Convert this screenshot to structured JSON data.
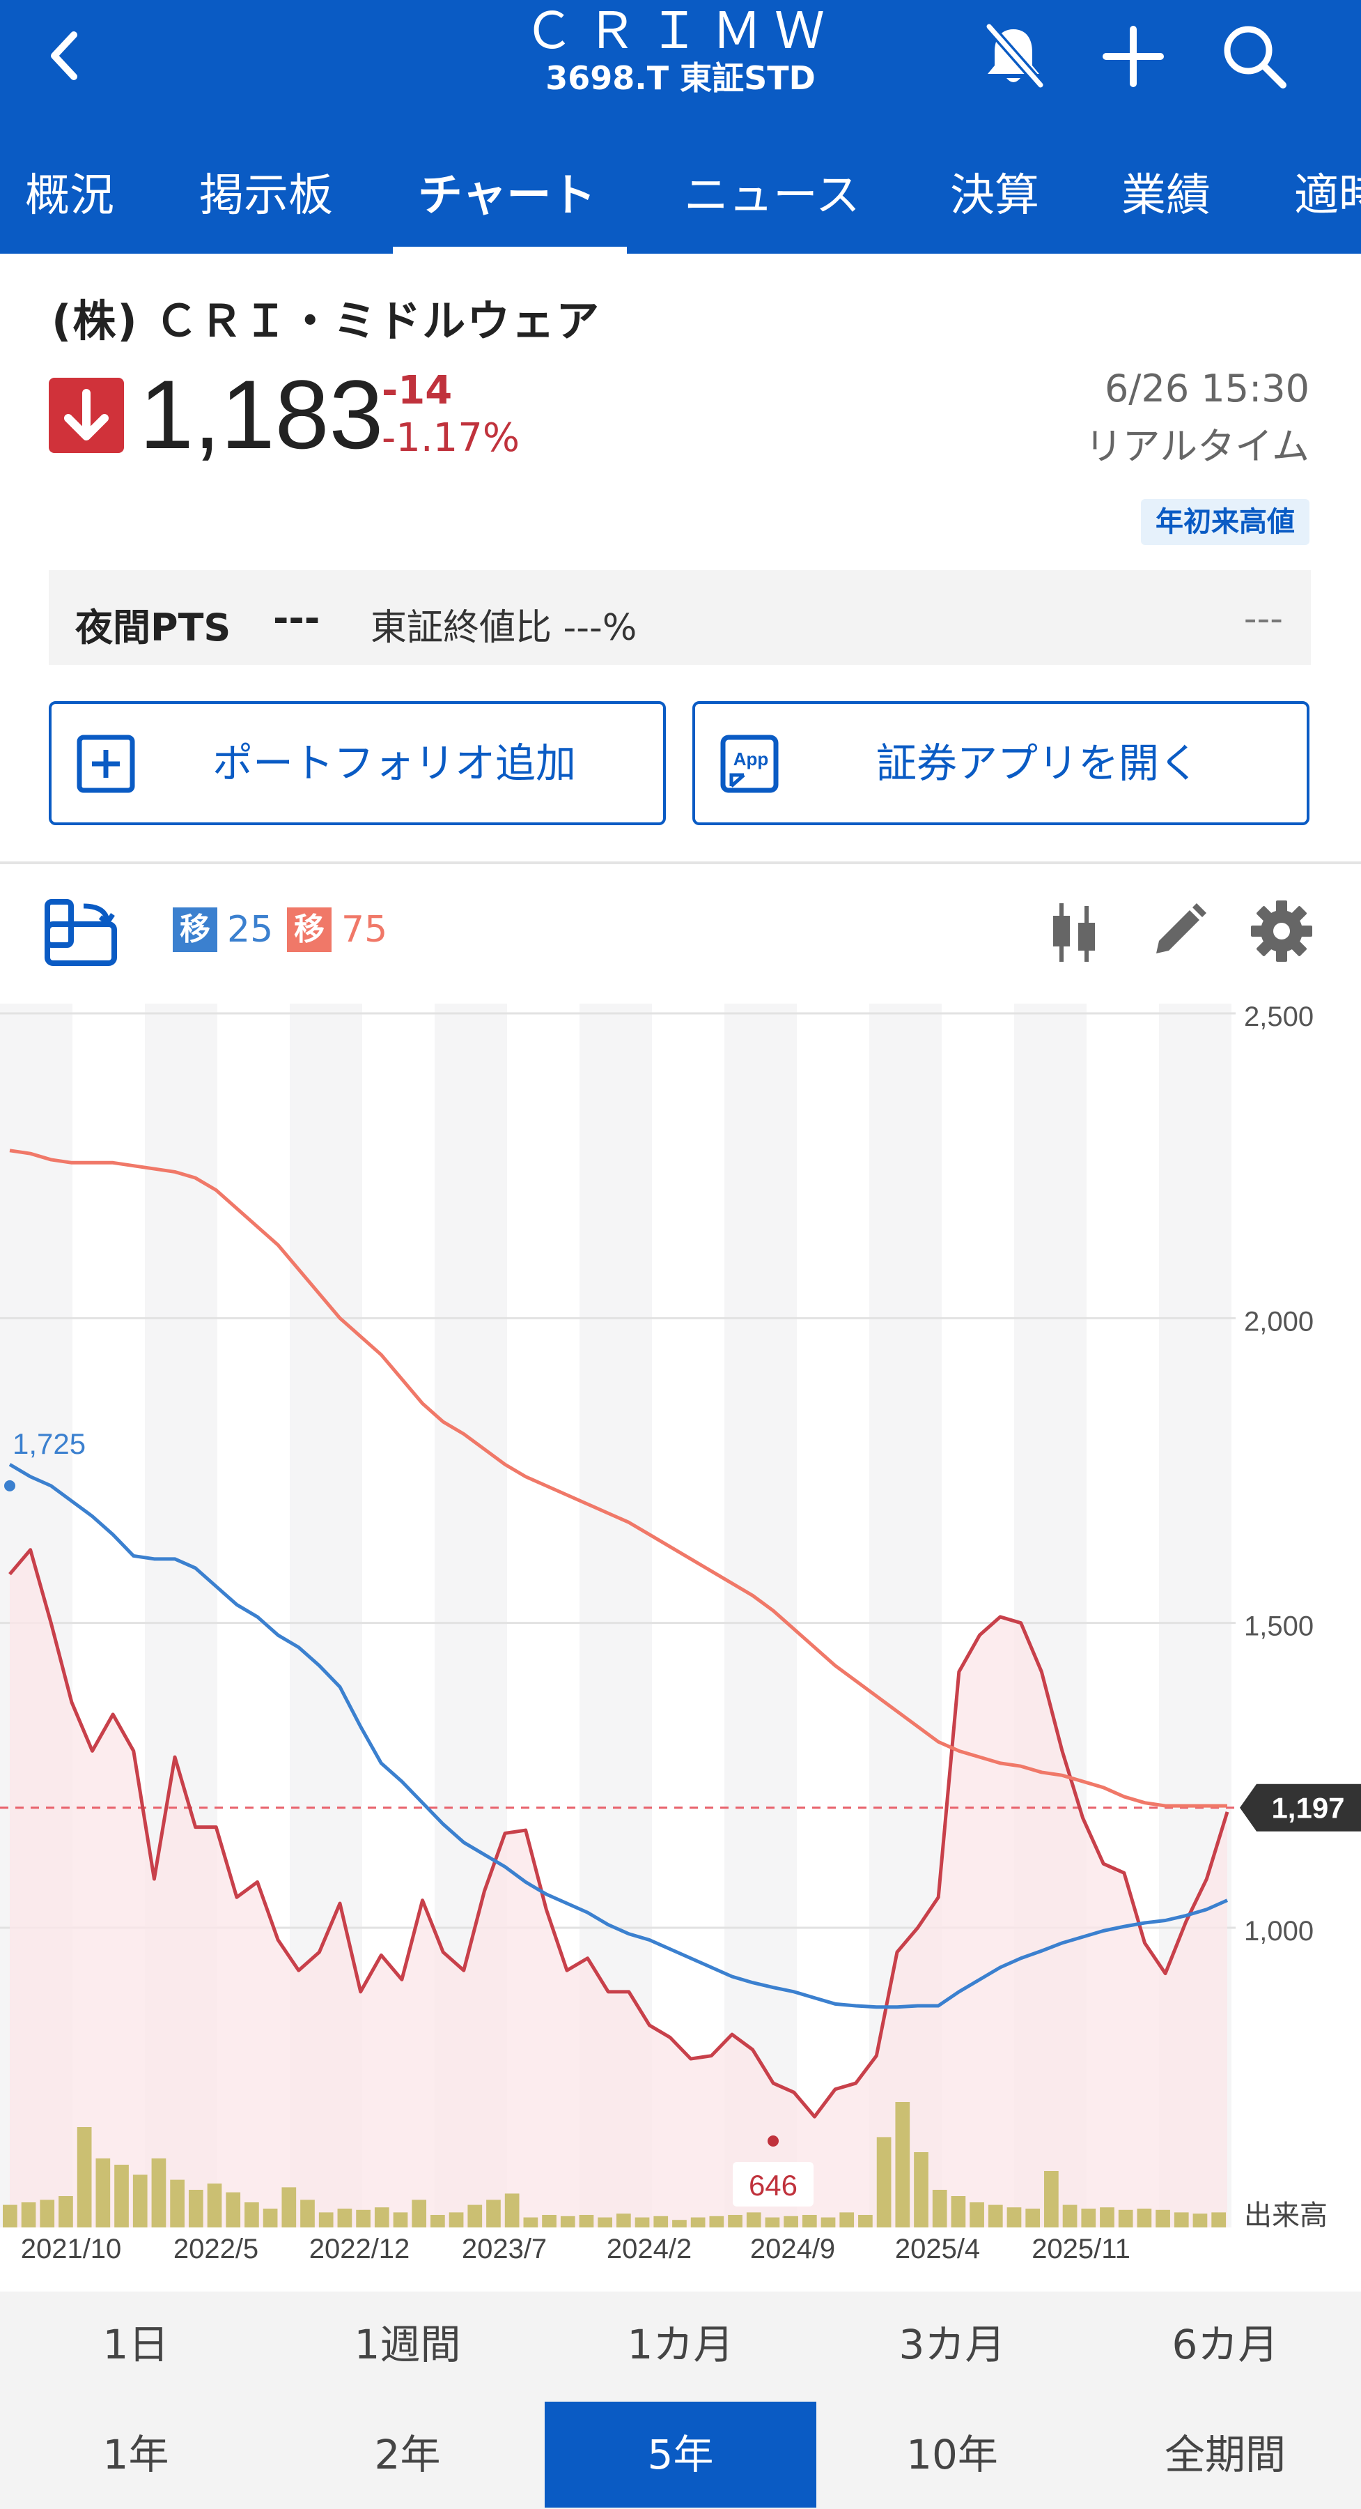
{
  "header": {
    "title": "ＣＲＩＭＷ",
    "subtitle": "3698.T 東証STD",
    "icons": {
      "back": "chevron-left-icon",
      "bell": "bell-off-icon",
      "add": "plus-icon",
      "search": "search-icon"
    },
    "brand_color": "#0a5bc4"
  },
  "tabs": [
    {
      "label": "概況"
    },
    {
      "label": "掲示板"
    },
    {
      "label": "チャート",
      "active": true
    },
    {
      "label": "ニュース"
    },
    {
      "label": "決算"
    },
    {
      "label": "業績"
    },
    {
      "label": "適時"
    }
  ],
  "stock": {
    "name": "(株) ＣＲＩ・ミドルウェア",
    "price": "1,183",
    "change": "-14",
    "change_pct": "-1.17%",
    "direction": "down",
    "timestamp": "6/26 15:30",
    "feed": "リアルタイム",
    "badge": "年初来高値",
    "down_color": "#d0323a"
  },
  "pts": {
    "label": "夜間PTS",
    "value": "---",
    "ratio": "東証終値比 ---%",
    "right": "---"
  },
  "actions": {
    "portfolio": "ポートフォリオ追加",
    "app": "証券アプリを開く",
    "app_icon_text": "App"
  },
  "chart_toolbar": {
    "ma_short_tag": "移",
    "ma_short_value": "25",
    "ma_long_tag": "移",
    "ma_long_value": "75",
    "ma_short_color": "#3b80cf",
    "ma_long_color": "#f07868"
  },
  "chart_data": {
    "type": "line",
    "y_ticks": [
      "2,500",
      "2,000",
      "1,500",
      "1,000"
    ],
    "x_ticks": [
      "2021/10",
      "2022/5",
      "2022/12",
      "2023/7",
      "2024/2",
      "2024/9",
      "2025/4",
      "2025/11"
    ],
    "ylim": [
      645,
      2500
    ],
    "volume_label": "出来高",
    "current_price_label": "1,197",
    "current_price": 1197,
    "high_label": "1,725",
    "low_label": "646",
    "series": [
      {
        "key": "price",
        "color": "#c8404a",
        "values": [
          1580,
          1620,
          1500,
          1370,
          1290,
          1350,
          1290,
          1080,
          1280,
          1165,
          1165,
          1050,
          1075,
          980,
          930,
          960,
          1040,
          895,
          955,
          915,
          1045,
          960,
          930,
          1060,
          1155,
          1160,
          1030,
          930,
          950,
          895,
          895,
          840,
          820,
          785,
          790,
          825,
          800,
          745,
          730,
          690,
          735,
          745,
          790,
          960,
          1000,
          1050,
          1420,
          1480,
          1510,
          1500,
          1420,
          1290,
          1180,
          1105,
          1090,
          975,
          925,
          1010,
          1080,
          1190
        ]
      },
      {
        "key": "ma25",
        "color": "#3b80cf",
        "values": [
          1760,
          1740,
          1725,
          1700,
          1675,
          1645,
          1610,
          1605,
          1605,
          1590,
          1560,
          1530,
          1510,
          1480,
          1460,
          1430,
          1395,
          1330,
          1270,
          1240,
          1205,
          1170,
          1140,
          1120,
          1100,
          1075,
          1055,
          1040,
          1025,
          1005,
          990,
          980,
          965,
          950,
          935,
          920,
          910,
          902,
          895,
          885,
          875,
          872,
          870,
          870,
          872,
          872,
          895,
          915,
          935,
          950,
          962,
          975,
          985,
          995,
          1002,
          1008,
          1012,
          1020,
          1030,
          1045
        ]
      },
      {
        "key": "ma75",
        "color": "#f07868",
        "values": [
          2275,
          2270,
          2260,
          2255,
          2255,
          2255,
          2250,
          2245,
          2240,
          2230,
          2210,
          2180,
          2150,
          2120,
          2080,
          2040,
          2000,
          1970,
          1940,
          1900,
          1860,
          1830,
          1810,
          1785,
          1760,
          1740,
          1725,
          1710,
          1695,
          1680,
          1665,
          1645,
          1625,
          1605,
          1585,
          1565,
          1545,
          1520,
          1490,
          1460,
          1430,
          1405,
          1380,
          1355,
          1330,
          1305,
          1290,
          1280,
          1270,
          1265,
          1255,
          1250,
          1240,
          1230,
          1215,
          1205,
          1200,
          1200,
          1200,
          1200
        ]
      }
    ],
    "volume": [
      18,
      20,
      22,
      25,
      80,
      55,
      50,
      42,
      55,
      38,
      30,
      35,
      28,
      20,
      15,
      32,
      22,
      12,
      15,
      14,
      16,
      12,
      22,
      10,
      12,
      18,
      22,
      27,
      8,
      10,
      9,
      10,
      8,
      11,
      8,
      9,
      6,
      8,
      9,
      10,
      12,
      8,
      9,
      10,
      8,
      12,
      10,
      72,
      100,
      60,
      30,
      25,
      20,
      18,
      16,
      15,
      45,
      18,
      15,
      16,
      14,
      15,
      14,
      12,
      11,
      12
    ]
  },
  "periods": {
    "row1": [
      "1日",
      "1週間",
      "1カ月",
      "3カ月",
      "6カ月"
    ],
    "row2": [
      "1年",
      "2年",
      "5年",
      "10年",
      "全期間"
    ],
    "active": "5年"
  }
}
